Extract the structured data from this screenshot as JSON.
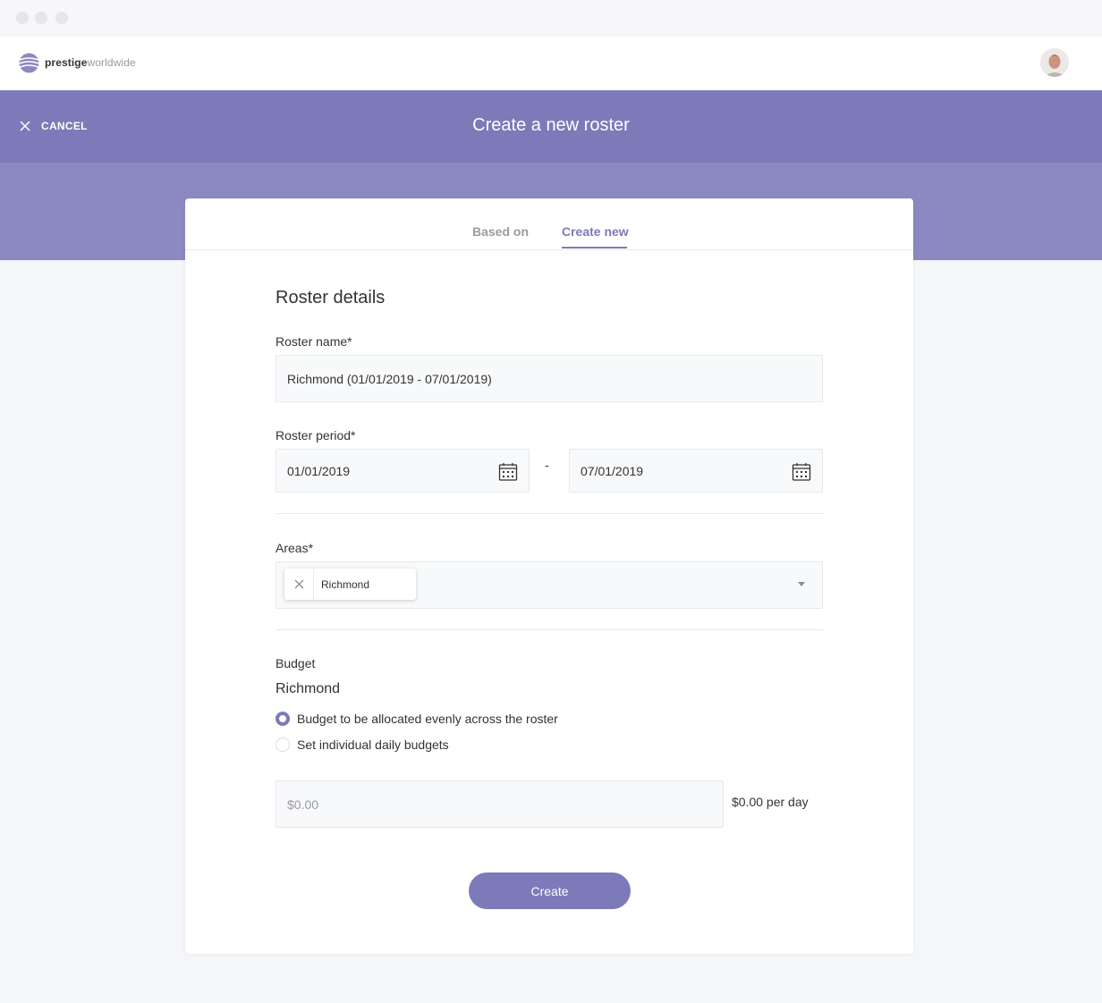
{
  "brand": {
    "bold": "prestige",
    "light": "worldwide",
    "color": "#7c7ab8"
  },
  "header": {
    "cancel_label": "CANCEL",
    "title": "Create a new roster"
  },
  "tabs": [
    {
      "label": "Based on",
      "active": false
    },
    {
      "label": "Create new",
      "active": true
    }
  ],
  "form": {
    "section_title": "Roster details",
    "roster_name": {
      "label": "Roster name*",
      "value": "Richmond (01/01/2019 - 07/01/2019)"
    },
    "roster_period": {
      "label": "Roster period*",
      "start": "01/01/2019",
      "separator": "-",
      "end": "07/01/2019"
    },
    "areas": {
      "label": "Areas*",
      "chips": [
        "Richmond"
      ]
    },
    "budget": {
      "label": "Budget",
      "area": "Richmond",
      "options": [
        {
          "label": "Budget to be allocated evenly across the roster",
          "selected": true
        },
        {
          "label": "Set individual daily budgets",
          "selected": false
        }
      ],
      "amount_placeholder": "$0.00",
      "per_day": "$0.00 per day"
    },
    "create_label": "Create"
  }
}
